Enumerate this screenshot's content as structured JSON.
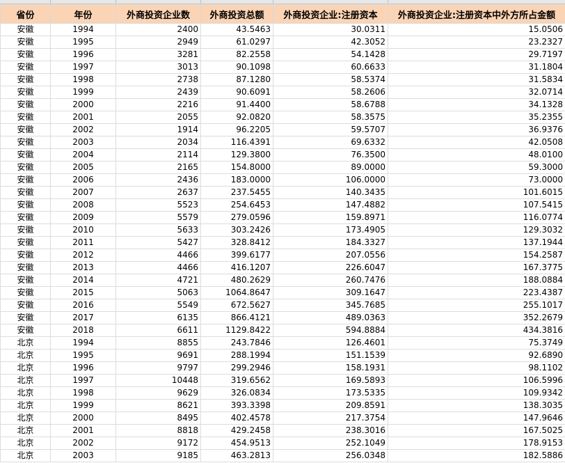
{
  "columns": [
    "省份",
    "年份",
    "外商投资企业数",
    "外商投资总额",
    "外商投资企业:注册资本",
    "外商投资企业:注册资本中外方所占金额"
  ],
  "rows": [
    [
      "安徽",
      "1994",
      "2400",
      "43.5463",
      "30.0311",
      "15.0506"
    ],
    [
      "安徽",
      "1995",
      "2949",
      "61.0297",
      "42.3052",
      "23.2327"
    ],
    [
      "安徽",
      "1996",
      "3281",
      "82.2558",
      "54.1428",
      "29.7197"
    ],
    [
      "安徽",
      "1997",
      "3013",
      "90.1098",
      "60.6633",
      "31.1804"
    ],
    [
      "安徽",
      "1998",
      "2738",
      "87.1280",
      "58.5374",
      "31.5834"
    ],
    [
      "安徽",
      "1999",
      "2439",
      "90.6091",
      "58.2606",
      "32.0714"
    ],
    [
      "安徽",
      "2000",
      "2216",
      "91.4400",
      "58.6788",
      "34.1328"
    ],
    [
      "安徽",
      "2001",
      "2055",
      "92.0820",
      "58.3575",
      "35.2355"
    ],
    [
      "安徽",
      "2002",
      "1914",
      "96.2205",
      "59.5707",
      "36.9376"
    ],
    [
      "安徽",
      "2003",
      "2034",
      "116.4391",
      "69.6332",
      "42.0508"
    ],
    [
      "安徽",
      "2004",
      "2114",
      "129.3800",
      "76.3500",
      "48.0100"
    ],
    [
      "安徽",
      "2005",
      "2165",
      "154.8000",
      "89.0000",
      "59.3000"
    ],
    [
      "安徽",
      "2006",
      "2436",
      "183.0000",
      "106.0000",
      "73.0000"
    ],
    [
      "安徽",
      "2007",
      "2637",
      "237.5455",
      "140.3435",
      "101.6015"
    ],
    [
      "安徽",
      "2008",
      "5523",
      "254.6453",
      "147.4882",
      "107.5415"
    ],
    [
      "安徽",
      "2009",
      "5579",
      "279.0596",
      "159.8971",
      "116.0774"
    ],
    [
      "安徽",
      "2010",
      "5633",
      "303.2426",
      "173.4905",
      "129.3032"
    ],
    [
      "安徽",
      "2011",
      "5427",
      "328.8412",
      "184.3327",
      "137.1944"
    ],
    [
      "安徽",
      "2012",
      "4466",
      "399.6177",
      "207.0556",
      "154.2587"
    ],
    [
      "安徽",
      "2013",
      "4466",
      "416.1207",
      "226.6047",
      "167.3775"
    ],
    [
      "安徽",
      "2014",
      "4721",
      "480.2629",
      "260.7476",
      "188.0884"
    ],
    [
      "安徽",
      "2015",
      "5063",
      "1064.8647",
      "309.1647",
      "223.4387"
    ],
    [
      "安徽",
      "2016",
      "5549",
      "672.5627",
      "345.7685",
      "255.1017"
    ],
    [
      "安徽",
      "2017",
      "6135",
      "866.4121",
      "489.0363",
      "352.2679"
    ],
    [
      "安徽",
      "2018",
      "6611",
      "1129.8422",
      "594.8884",
      "434.3816"
    ],
    [
      "北京",
      "1994",
      "8855",
      "243.7846",
      "126.4601",
      "75.3749"
    ],
    [
      "北京",
      "1995",
      "9691",
      "288.1994",
      "151.1539",
      "92.6890"
    ],
    [
      "北京",
      "1996",
      "9797",
      "299.2946",
      "158.1931",
      "98.1102"
    ],
    [
      "北京",
      "1997",
      "10448",
      "319.6562",
      "169.5893",
      "106.5996"
    ],
    [
      "北京",
      "1998",
      "9629",
      "326.0834",
      "173.5335",
      "109.9342"
    ],
    [
      "北京",
      "1999",
      "8621",
      "393.3398",
      "209.8591",
      "138.3035"
    ],
    [
      "北京",
      "2000",
      "8495",
      "402.4578",
      "217.3754",
      "147.9646"
    ],
    [
      "北京",
      "2001",
      "8818",
      "429.2458",
      "238.3016",
      "167.5025"
    ],
    [
      "北京",
      "2002",
      "9172",
      "454.9513",
      "252.1049",
      "178.9153"
    ],
    [
      "北京",
      "2003",
      "9185",
      "463.2813",
      "256.0348",
      "182.5886"
    ]
  ]
}
